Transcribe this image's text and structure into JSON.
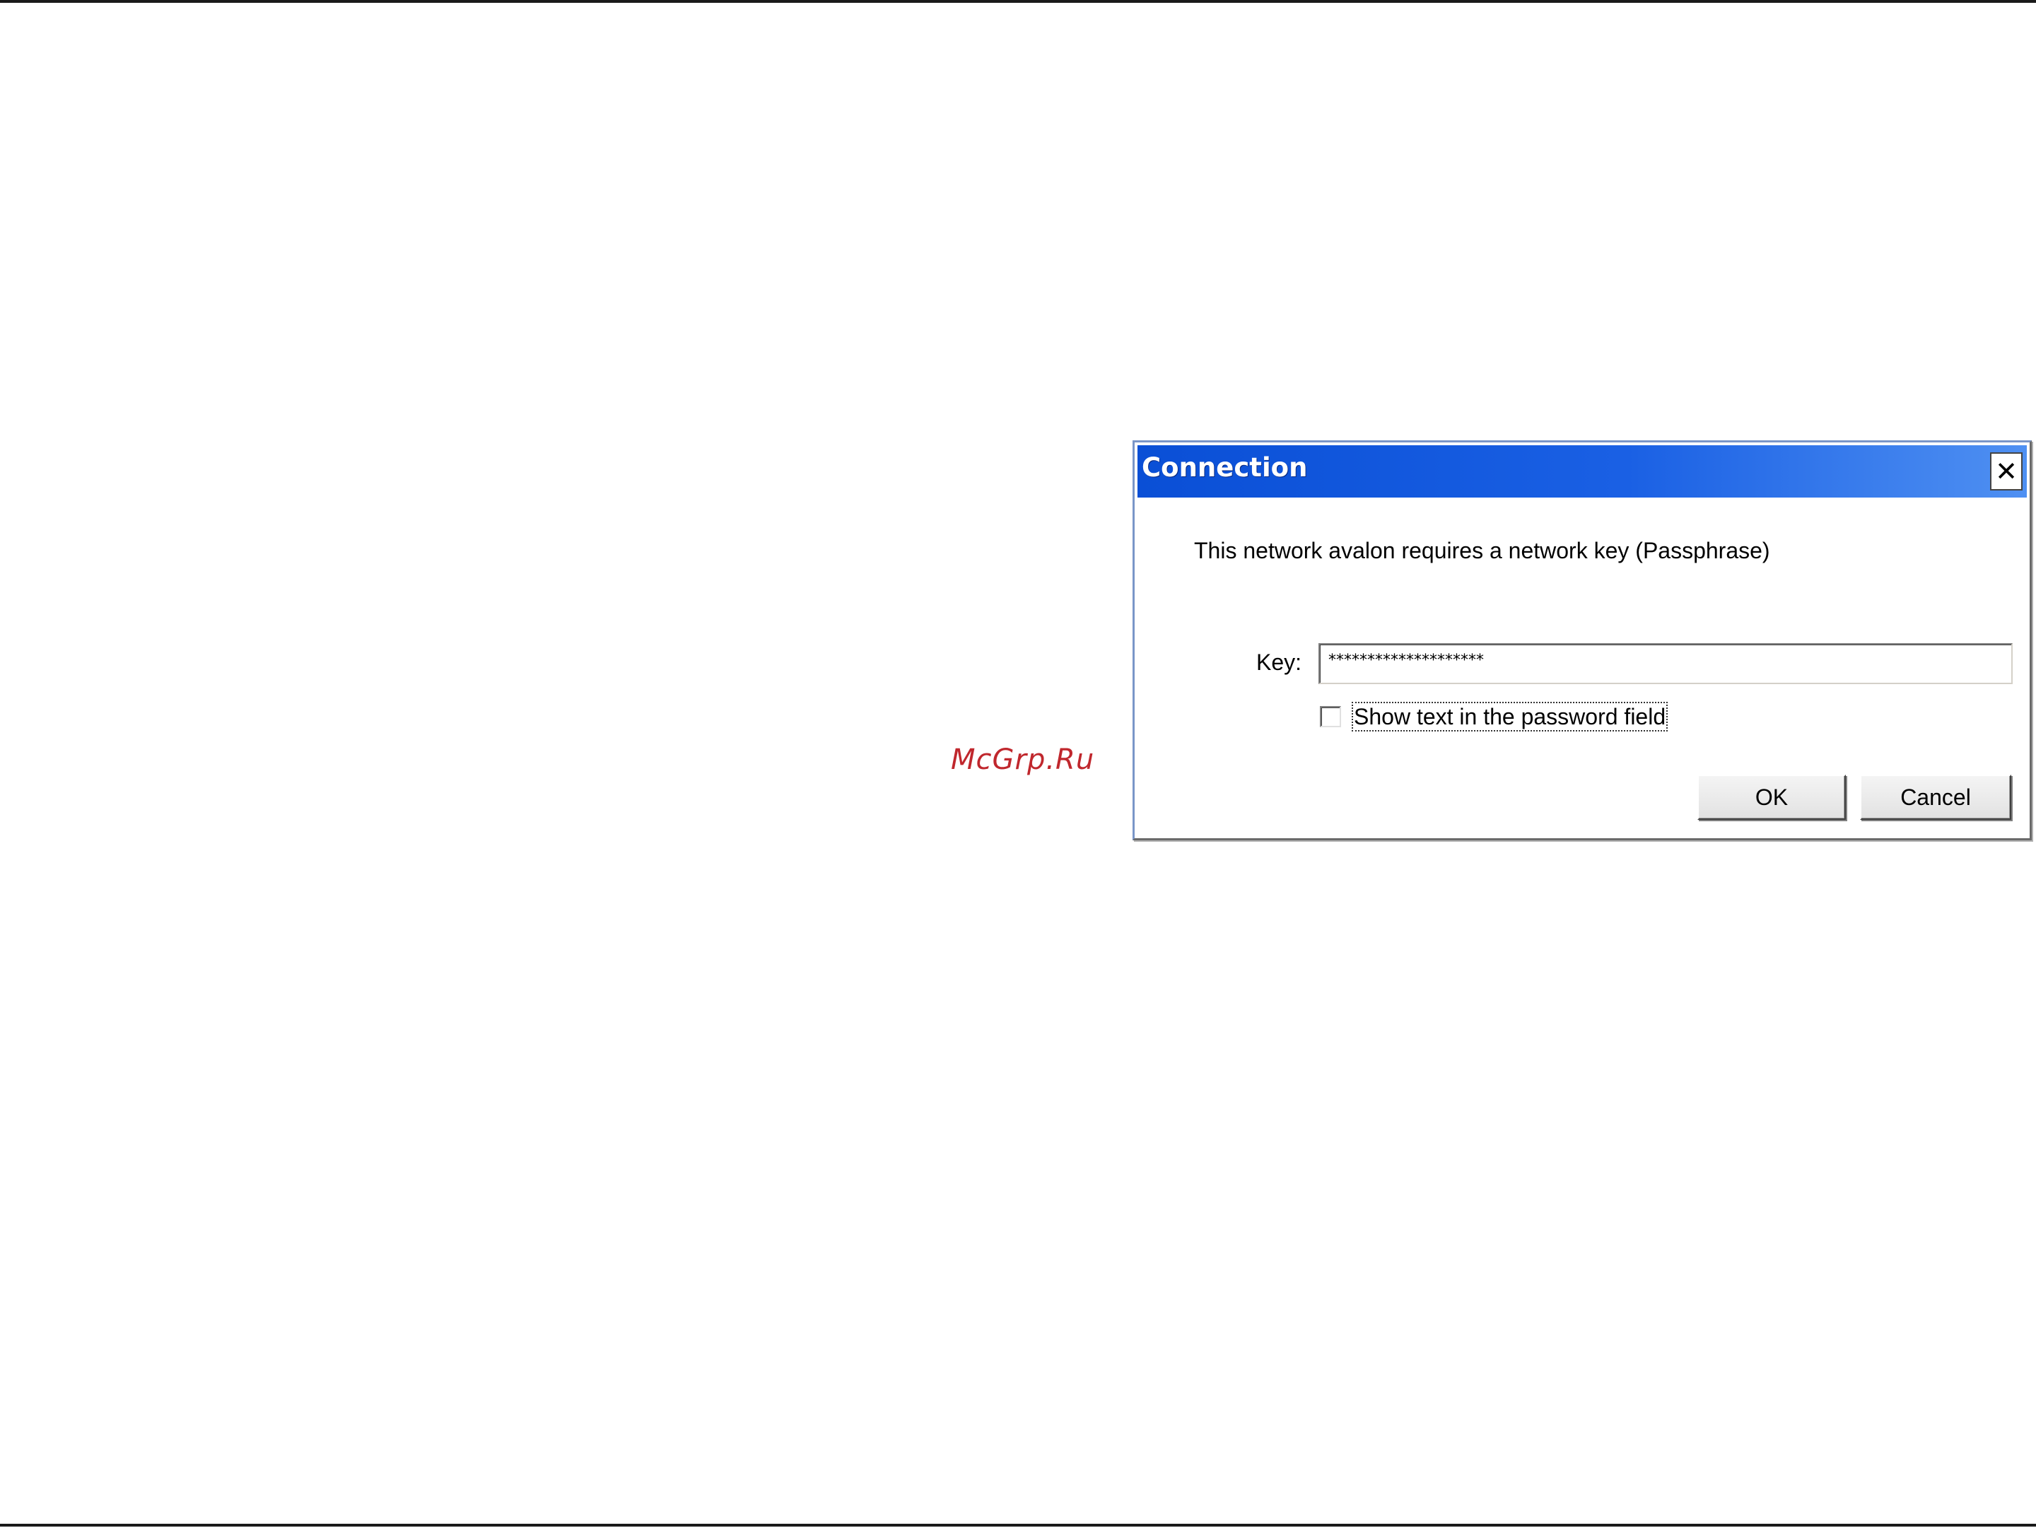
{
  "watermark": {
    "text": "McGrp.Ru"
  },
  "dialog": {
    "title": "Connection",
    "close_glyph": "✕",
    "message": "This network avalon requires a network key (Passphrase)",
    "key_label": "Key:",
    "key_value": "********************",
    "show_text_label": "Show text in the password field",
    "show_text_checked": false,
    "ok_label": "OK",
    "cancel_label": "Cancel"
  },
  "colors": {
    "titlebar_start": "#0a4fd6",
    "titlebar_end": "#4f90f2",
    "watermark": "#c0272d"
  },
  "icons": {
    "close": "close-icon"
  }
}
